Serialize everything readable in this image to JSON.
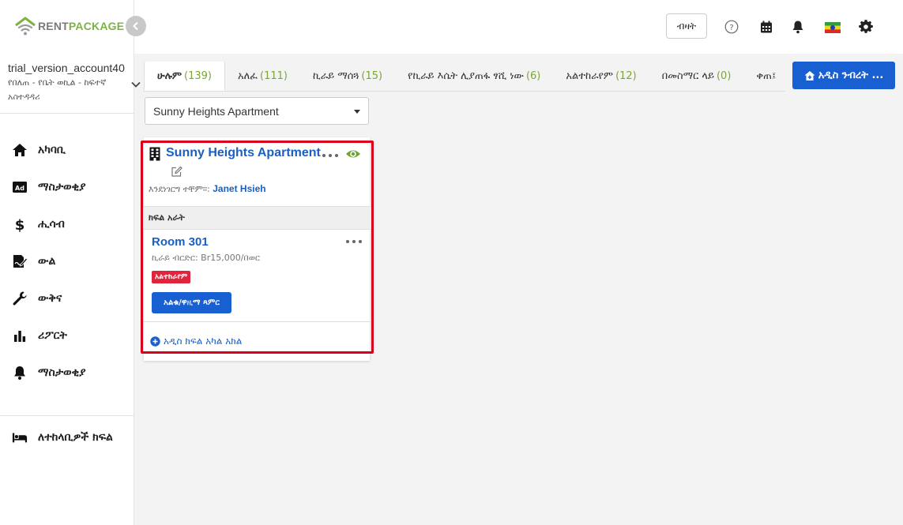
{
  "brand": {
    "part1": "RENT",
    "part2": "PACKAGE"
  },
  "account": {
    "name": "trial_version_account40",
    "role": "የበለጠ - የቤት ወኪል - ከፍተኛ አስተዳዳሪ"
  },
  "sidebar": {
    "items": [
      {
        "label": "አካባቢ",
        "icon": "home-icon"
      },
      {
        "label": "ማስታወቂያ",
        "icon": "ad-icon"
      },
      {
        "label": "ሒሳብ",
        "icon": "dollar-icon"
      },
      {
        "label": "ውል",
        "icon": "contract-icon"
      },
      {
        "label": "ውቅና",
        "icon": "wrench-icon"
      },
      {
        "label": "ሪፖርት",
        "icon": "report-icon"
      },
      {
        "label": "ማስታወቂያ",
        "icon": "bell-icon"
      }
    ],
    "extra": {
      "label": "ለተከላቢዎች ክፍል",
      "icon": "bed-icon"
    }
  },
  "header": {
    "more_label": "ብዛት",
    "icons": [
      "help-icon",
      "calendar-icon",
      "notification-bell-icon",
      "flag-icon",
      "settings-gear-icon"
    ]
  },
  "tabs": [
    {
      "label": "ሁሉም",
      "count": "(139)",
      "active": true
    },
    {
      "label": "አለፈ",
      "count": "(111)"
    },
    {
      "label": "ኪራይ ማሰጓ",
      "count": "(15)"
    },
    {
      "label": "የኪራይ እሴት ሊያጠፋ ፃሺ ነው",
      "count": "(6)"
    },
    {
      "label": "አልተከራየም",
      "count": "(12)"
    },
    {
      "label": "በመስማር ላይ",
      "count": "(0)"
    },
    {
      "label": "ቀጠ፤",
      "count": ""
    }
  ],
  "add_property_label": "አዲስ ንብረት ...",
  "property_select": {
    "value": "Sunny Heights Apartment"
  },
  "property_card": {
    "title": "Sunny Heights Apartment",
    "managed_by_label": "እንደነገርግ ተቸም።:",
    "manager": "Janet Hsieh",
    "section_title": "ክፍል አራት",
    "room": {
      "name": "Room 301",
      "rent_label": "ኪራይ ብርድር:",
      "rent_value": "Br15,000/በወር",
      "status": "አልተከራየም",
      "action_label": "አልቁ/ዋዚማ ጻምር"
    },
    "add_room_label": "አዲስ ክፍል አካል አክል"
  },
  "colors": {
    "primary": "#1860d2",
    "link": "#1a5fc4",
    "accent_green": "#7cb342",
    "count_green": "#7aa635",
    "danger": "#e0243b",
    "highlight": "#d9001b"
  }
}
